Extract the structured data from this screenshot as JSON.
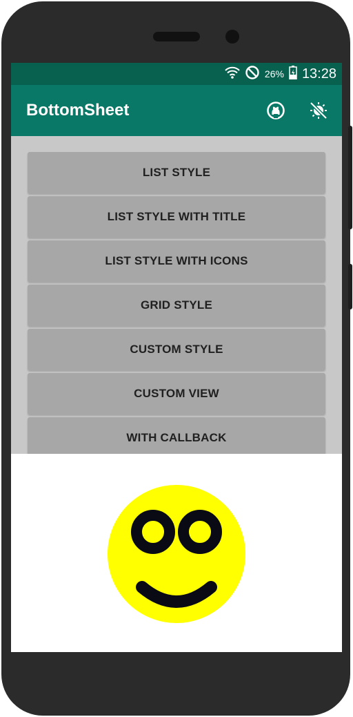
{
  "status_bar": {
    "battery_percent": "26%",
    "time": "13:28",
    "icons": [
      "wifi-icon",
      "do-not-disturb-icon",
      "battery-charging-icon"
    ]
  },
  "app_bar": {
    "title": "BottomSheet",
    "actions": [
      "github-icon",
      "theme-toggle-icon"
    ]
  },
  "buttons": [
    {
      "label": "LIST STYLE"
    },
    {
      "label": "LIST STYLE WITH TITLE"
    },
    {
      "label": "LIST STYLE WITH ICONS"
    },
    {
      "label": "GRID STYLE"
    },
    {
      "label": "CUSTOM STYLE"
    },
    {
      "label": "CUSTOM VIEW"
    },
    {
      "label": "WITH CALLBACK"
    }
  ],
  "bottom_sheet": {
    "content": "smiley-face-icon"
  },
  "colors": {
    "status_bar": "#08604f",
    "app_bar": "#0a7866",
    "button": "#a6a7a6",
    "scrim_background": "#c8c8c8",
    "smiley_face": "#ffff00",
    "smiley_features": "#0a0a14"
  }
}
